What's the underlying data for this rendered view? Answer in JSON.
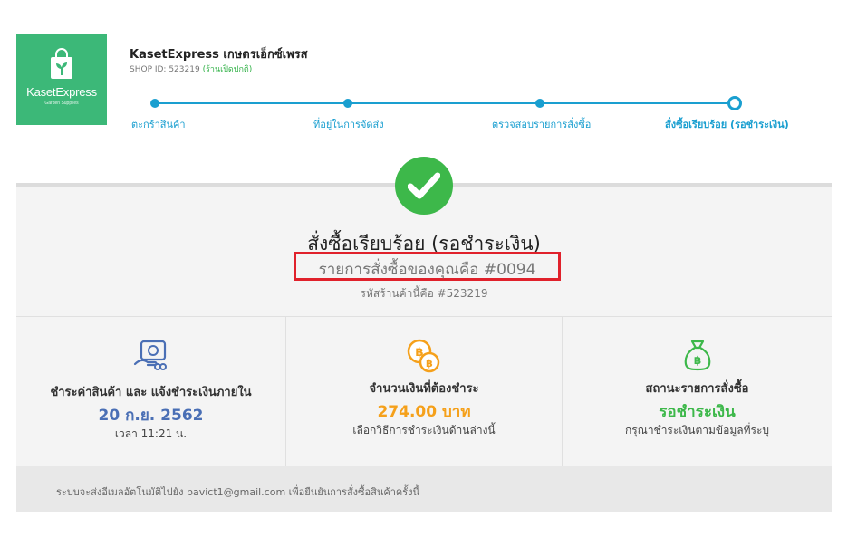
{
  "logo": {
    "brand": "KasetExpress",
    "tagline": "Garden Supplies",
    "color": "#3cb878"
  },
  "shop": {
    "name": "KasetExpress เกษตรเอ็กซ์เพรส",
    "id_text": "SHOP ID: 523219",
    "status": "(ร้านเปิดปกติ)"
  },
  "steps": [
    {
      "label": "ตะกร้าสินค้า"
    },
    {
      "label": "ที่อยู่ในการจัดส่ง"
    },
    {
      "label": "ตรวจสอบรายการสั่งซื้อ"
    },
    {
      "label": "สั่งซื้อเรียบร้อย (รอชำระเงิน)"
    }
  ],
  "confirmation": {
    "title": "สั่งซื้อเรียบร้อย (รอชำระเงิน)",
    "order_line": "รายการสั่งซื้อของคุณคือ #0094",
    "shop_code": "รหัสร้านค้านี้คือ #523219"
  },
  "info": {
    "payment_due": {
      "icon": "cash-payment-icon",
      "heading": "ชำระค่าสินค้า และ แจ้งชำระเงินภายใน",
      "date": "20 ก.ย. 2562",
      "time": "เวลา 11:21 น.",
      "color": "#4a6fb5"
    },
    "amount": {
      "icon": "coins-icon",
      "heading": "จำนวนเงินที่ต้องชำระ",
      "value": "274.00 บาท",
      "note": "เลือกวิธีการชำระเงินด้านล่างนี้",
      "color": "#f5a01a"
    },
    "status": {
      "icon": "money-bag-icon",
      "heading": "สถานะรายการสั่งซื้อ",
      "value": "รอชำระเงิน",
      "note": "กรุณาชำระเงินตามข้อมูลที่ระบุ",
      "color": "#3db84a"
    }
  },
  "footer": {
    "note": "ระบบจะส่งอีเมลอัตโนมัติไปยัง bavict1@gmail.com เพื่อยืนยันการสั่งซื้อสินค้าครั้งนี้"
  }
}
